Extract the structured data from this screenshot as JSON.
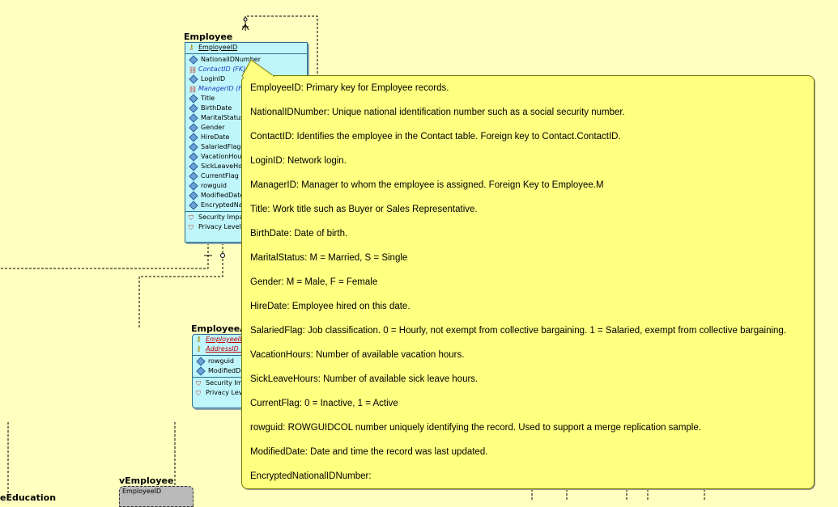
{
  "employee": {
    "title": "Employee",
    "pk": "EmployeeID",
    "attributes": [
      {
        "name": "NationalIDNumber",
        "type": "attr"
      },
      {
        "name": "ContactID (FK)",
        "type": "fk"
      },
      {
        "name": "LoginID",
        "type": "attr"
      },
      {
        "name": "ManagerID (FK)",
        "type": "fk"
      },
      {
        "name": "Title",
        "type": "attr"
      },
      {
        "name": "BirthDate",
        "type": "attr"
      },
      {
        "name": "MaritalStatus",
        "type": "attr"
      },
      {
        "name": "Gender",
        "type": "attr"
      },
      {
        "name": "HireDate",
        "type": "attr"
      },
      {
        "name": "SalariedFlag",
        "type": "attr"
      },
      {
        "name": "VacationHours",
        "type": "attr"
      },
      {
        "name": "SickLeaveHours",
        "type": "attr"
      },
      {
        "name": "CurrentFlag",
        "type": "attr"
      },
      {
        "name": "rowguid",
        "type": "attr"
      },
      {
        "name": "ModifiedDate",
        "type": "attr"
      },
      {
        "name": "EncryptedNation",
        "type": "attr"
      }
    ],
    "security": [
      "Security Impact:",
      "Privacy Level:"
    ]
  },
  "employee_address": {
    "title": "EmployeeA",
    "keys": [
      "EmployeeID (",
      "AddressID (F"
    ],
    "attributes": [
      "rowguid",
      "ModifiedDate"
    ],
    "security": [
      "Security Impac",
      "Privacy Level:"
    ]
  },
  "vemployee": {
    "title": "vEmployee",
    "field": "EmployeeID"
  },
  "employee_education": {
    "title": "eEducation"
  },
  "tooltip": {
    "lines": [
      "EmployeeID: Primary key for Employee records.",
      "NationalIDNumber: Unique national identification number such as a social security number.",
      "ContactID: Identifies the employee in the Contact table. Foreign key to Contact.ContactID.",
      "LoginID: Network login.",
      "ManagerID: Manager to whom the employee is assigned. Foreign Key to Employee.M",
      "Title: Work title such as Buyer or Sales Representative.",
      "BirthDate: Date of birth.",
      "MaritalStatus: M = Married, S = Single",
      "Gender: M = Male, F = Female",
      "HireDate: Employee hired on this date.",
      "SalariedFlag: Job classification. 0 = Hourly, not exempt from collective bargaining. 1 = Salaried, exempt from collective bargaining.",
      "VacationHours: Number of available vacation hours.",
      "SickLeaveHours: Number of available sick leave hours.",
      "CurrentFlag: 0 = Inactive, 1 = Active",
      "rowguid: ROWGUIDCOL number uniquely identifying the record. Used to support a merge replication sample.",
      "ModifiedDate: Date and time the record was last updated.",
      "EncryptedNationalIDNumber:"
    ]
  },
  "colors": {
    "background": "#ffffc0",
    "entity_fill": "#bff6fb",
    "tooltip_fill": "#ffff80",
    "fk_text": "#1f3fbf",
    "pkfk_text": "#c00000"
  }
}
